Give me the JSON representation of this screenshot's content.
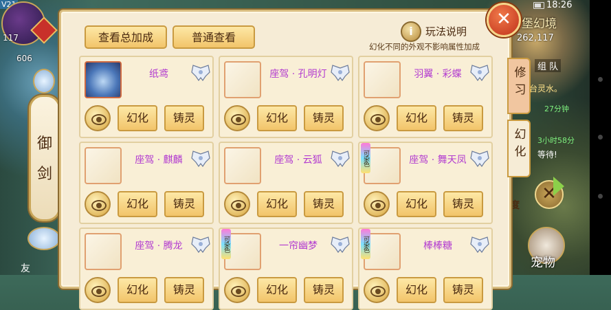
{
  "hud": {
    "version": "V21",
    "time": "18:26",
    "level": "117",
    "hp": "606",
    "map_name": "家堡幻境",
    "coords": "262,117",
    "team_label": "组 队",
    "chat_1": "台灵水。",
    "chat_2": "27分钟",
    "chat_3": "3小时58分",
    "chat_4": "等待!",
    "pet_label": "宠物",
    "left_char": "友",
    "tie_char": "度"
  },
  "sword_tab": {
    "char1": "御",
    "char2": "剑"
  },
  "panel": {
    "btn_total": "查看总加成",
    "btn_normal": "普通查看",
    "rules_label": "玩法说明",
    "rules_note": "幻化不同的外观不影响属性加成",
    "close": "✕",
    "info_glyph": "i"
  },
  "side_tabs": {
    "practice": "修习",
    "transform": "幻化"
  },
  "cards": [
    {
      "name": "纸鸢",
      "dye": false,
      "img": true
    },
    {
      "name": "座驾 · 孔明灯",
      "dye": false,
      "img": false
    },
    {
      "name": "羽翼 · 彩蝶",
      "dye": false,
      "img": false
    },
    {
      "name": "座驾 · 麒麟",
      "dye": false,
      "img": false
    },
    {
      "name": "座驾 · 云狐",
      "dye": false,
      "img": false
    },
    {
      "name": "座驾 · 舞天凤",
      "dye": true,
      "img": false
    },
    {
      "name": "座驾 · 腾龙",
      "dye": false,
      "img": false
    },
    {
      "name": "一帘幽梦",
      "dye": true,
      "img": false
    },
    {
      "name": "棒棒糖",
      "dye": true,
      "img": false
    }
  ],
  "card_labels": {
    "transform": "幻化",
    "refine": "铸灵",
    "dye_tag": "可染色"
  },
  "icons": {
    "eye": "eye-icon",
    "wing": "wing-icon",
    "info": "info-icon",
    "close": "close-icon",
    "arrow": "arrow-right-icon"
  },
  "colors": {
    "name_purple": "#b23bd0",
    "button_gold": "#f2c46a",
    "close_red": "#c0301a"
  }
}
